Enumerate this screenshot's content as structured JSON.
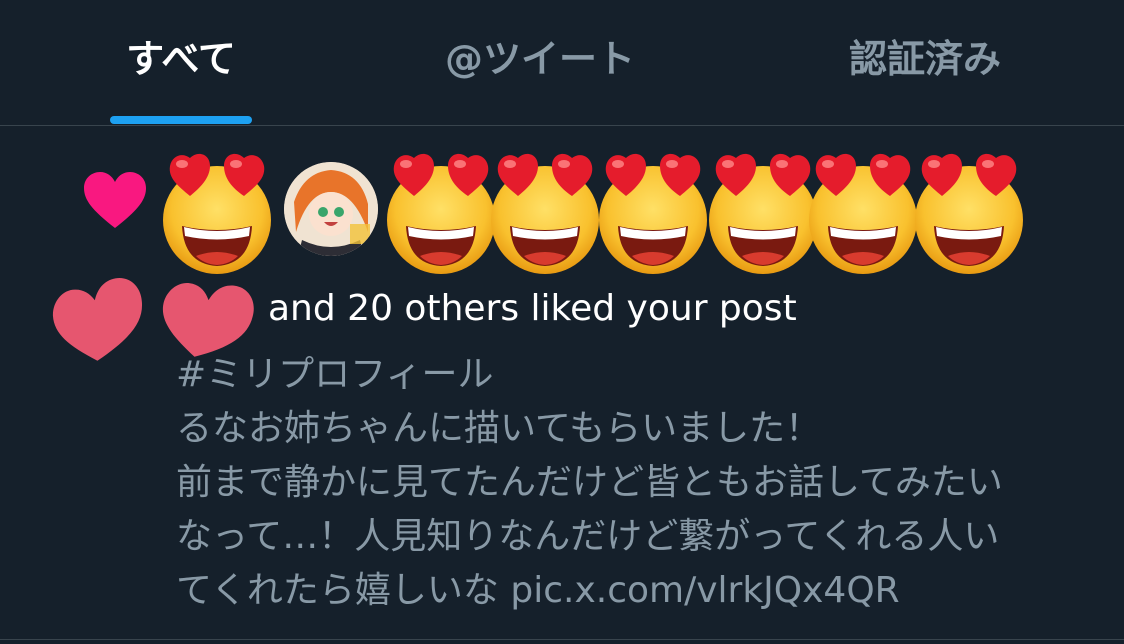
{
  "tabs": {
    "all": "すべて",
    "tweets": "@ツイート",
    "verified": "認証済み"
  },
  "notification": {
    "icon": "heart-icon",
    "likers": [
      {
        "type": "emoji",
        "name": "heart-eyes-emoji"
      },
      {
        "type": "avatar",
        "name": "anime-girl-avatar"
      },
      {
        "type": "emoji",
        "name": "heart-eyes-emoji"
      },
      {
        "type": "emoji",
        "name": "heart-eyes-emoji"
      },
      {
        "type": "emoji",
        "name": "heart-eyes-emoji"
      },
      {
        "type": "emoji",
        "name": "heart-eyes-emoji"
      },
      {
        "type": "emoji",
        "name": "heart-eyes-emoji"
      },
      {
        "type": "emoji",
        "name": "heart-eyes-emoji"
      }
    ],
    "summary": "and 20 others liked your post",
    "post_text": "#ミリプロフィール\nるなお姉ちゃんに描いてもらいました！\n前まで静かに見てたんだけど皆ともお話してみたい\nなって…！人見知りなんだけど繋がってくれる人い\nてくれたら嬉しいな pic.x.com/vlrkJQx4QR"
  },
  "colors": {
    "background": "#15202b",
    "accent": "#1da1f2",
    "heart": "#f91880",
    "muted_text": "#8899a6"
  }
}
